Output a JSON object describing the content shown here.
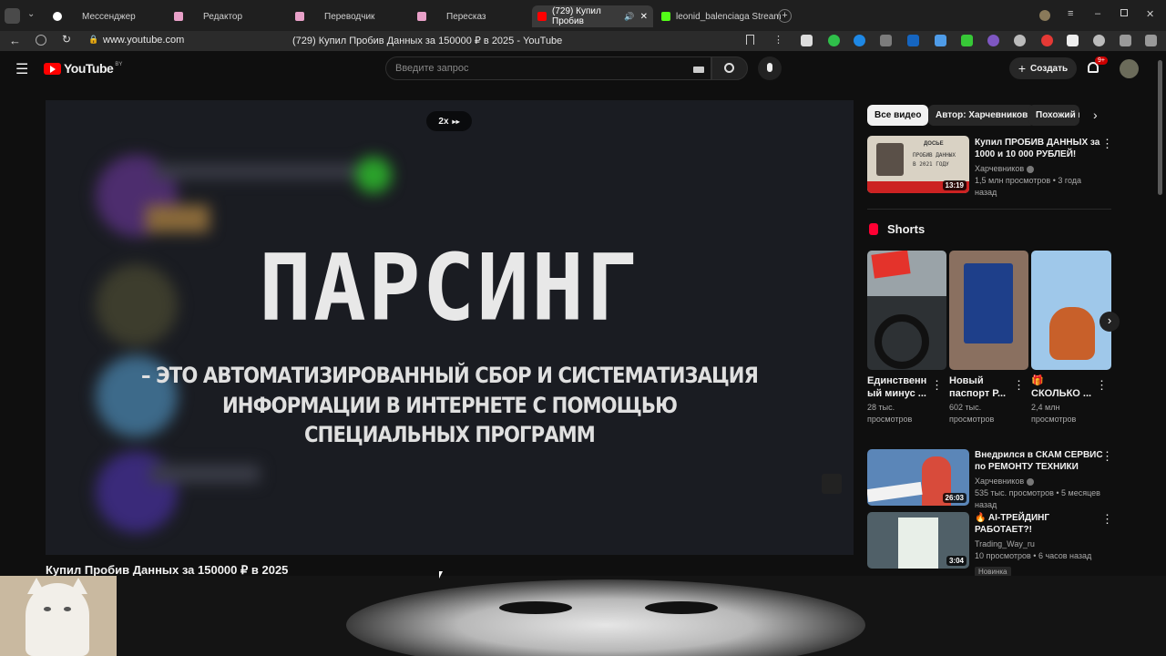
{
  "browser": {
    "tabs": [
      {
        "label": "Мессенджер"
      },
      {
        "label": "Редактор"
      },
      {
        "label": "Переводчик"
      },
      {
        "label": "Пересказ"
      },
      {
        "label": "(729) Купил Пробив"
      },
      {
        "label": "leonid_balenciaga Stream"
      }
    ],
    "url": "www.youtube.com",
    "page_title": "(729) Купил Пробив Данных за 150000 ₽ в 2025 - YouTube"
  },
  "youtube": {
    "logo": "YouTube",
    "region": "BY",
    "search_placeholder": "Введите запрос",
    "create_label": "Создать",
    "notif_badge": "9+"
  },
  "player": {
    "speed": "2x",
    "overlay_heading": "ПАРСИНГ",
    "overlay_line1": "– ЭТО АВТОМАТИЗИРОВАННЫЙ СБОР И СИСТЕМАТИЗАЦИЯ",
    "overlay_line2": "ИНФОРМАЦИИ В ИНТЕРНЕТЕ С ПОМОЩЬЮ",
    "overlay_line3": "СПЕЦИАЛЬНЫХ ПРОГРАММ",
    "video_title": "Купил Пробив Данных за 150000 ₽ в 2025"
  },
  "chips": [
    "Все видео",
    "Автор: Харчевников",
    "Похожий к"
  ],
  "recommendations": [
    {
      "title1": "Купил ПРОБИВ ДАННЫХ за",
      "title2": "1000 и 10 000 РУБЛЕЙ!",
      "channel": "Харчевников",
      "meta": "1,5 млн просмотров • 3 года назад",
      "duration": "13:19",
      "thumb_text1": "ДОСЬЕ",
      "thumb_text2": "ПРОБИВ ДАННЫХ",
      "thumb_text3": "В 2021 ГОДУ"
    },
    {
      "title1": "Внедрился в СКАМ СЕРВИС",
      "title2": "по РЕМОНТУ ТЕХНИКИ",
      "channel": "Харчевников",
      "meta": "535 тыс. просмотров • 5 месяцев назад",
      "duration": "26:03"
    },
    {
      "title1": "AI-ТРЕЙДИНГ РАБОТАЕТ?!",
      "channel": "Trading_Way_ru",
      "meta": "10 просмотров • 6 часов назад",
      "badge": "Новинка",
      "duration": "3:04"
    }
  ],
  "shorts": {
    "header": "Shorts",
    "items": [
      {
        "title1": "Единственн",
        "title2": "ый минус ...",
        "views1": "28 тыс.",
        "views2": "просмотров"
      },
      {
        "title1": "Новый",
        "title2": "паспорт Р...",
        "views1": "602 тыс.",
        "views2": "просмотров"
      },
      {
        "title1": "🎁",
        "title2": "СКОЛЬКО ...",
        "views1": "2,4 млн",
        "views2": "просмотров"
      }
    ]
  },
  "colors": {
    "bg": "#0f0f0f",
    "accent": "#ff0000",
    "chip_active": "#f1f1f1"
  }
}
